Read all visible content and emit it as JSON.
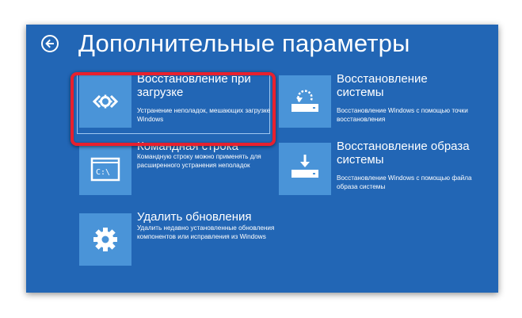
{
  "header": {
    "title": "Дополнительные параметры",
    "back_icon": "back-arrow-icon"
  },
  "options": [
    {
      "id": "startup-repair",
      "title": "Восстановление при загрузке",
      "description": "Устранение неполадок, мешающих загрузке Windows",
      "icon": "startup-repair-icon",
      "selected": true
    },
    {
      "id": "system-restore",
      "title": "Восстановление системы",
      "description": "Восстановление Windows с помощью точки восстановления",
      "icon": "system-restore-icon"
    },
    {
      "id": "command-prompt",
      "title": "Командная строка",
      "description": "Командную строку можно применять для расширенного устранения неполадок",
      "icon": "command-prompt-icon",
      "icon_text": "C:\\"
    },
    {
      "id": "system-image-recovery",
      "title": "Восстановление образа системы",
      "description": "Восстановление Windows с помощью файла образа системы",
      "icon": "system-image-icon"
    },
    {
      "id": "uninstall-updates",
      "title": "Удалить обновления",
      "description": "Удалить недавно установленные обновления компонентов или исправления из Windows",
      "icon": "gear-icon"
    }
  ],
  "colors": {
    "background": "#2266b5",
    "tile": "#4a94d8",
    "highlight": "#e8202e"
  }
}
